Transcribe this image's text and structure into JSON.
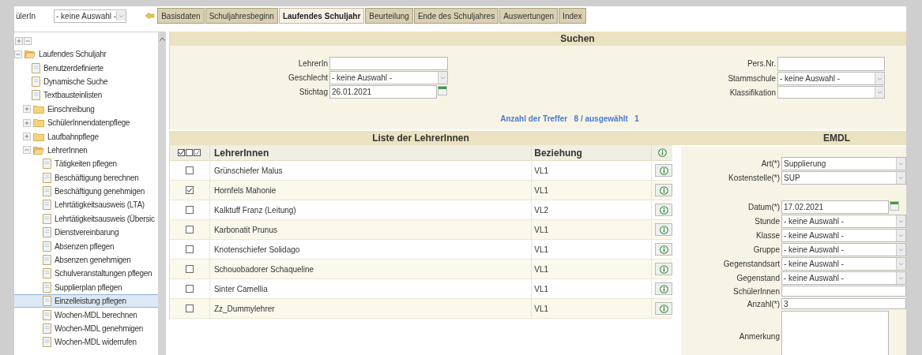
{
  "top_bar": {
    "label": "ülerIn",
    "select_value": "- keine Auswahl -"
  },
  "tabs": [
    {
      "label": "Basisdaten",
      "selected": false
    },
    {
      "label": "Schuljahresbeginn",
      "selected": false
    },
    {
      "label": "Laufendes Schuljahr",
      "selected": true
    },
    {
      "label": "Beurteilung",
      "selected": false
    },
    {
      "label": "Ende des Schuljahres",
      "selected": false
    },
    {
      "label": "Auswertungen",
      "selected": false
    },
    {
      "label": "Index",
      "selected": false
    }
  ],
  "sidebar": {
    "tree": [
      {
        "label": "Laufendes Schuljahr",
        "kind": "folder",
        "expanded": true,
        "selected": false,
        "children": [
          {
            "label": "Benutzerdefinierte",
            "kind": "page",
            "selected": false
          },
          {
            "label": "Dynamische Suche",
            "kind": "page",
            "selected": false
          },
          {
            "label": "Textbausteinlisten",
            "kind": "page",
            "selected": false
          },
          {
            "label": "Einschreibung",
            "kind": "folder",
            "expanded": false,
            "selected": false
          },
          {
            "label": "SchülerInnendatenpflege",
            "kind": "folder",
            "expanded": false,
            "selected": false
          },
          {
            "label": "Laufbahnpflege",
            "kind": "folder",
            "expanded": false,
            "selected": false
          },
          {
            "label": "LehrerInnen",
            "kind": "folder",
            "expanded": true,
            "selected": false,
            "children": [
              {
                "label": "Tätigkeiten pflegen",
                "kind": "page",
                "selected": false
              },
              {
                "label": "Beschäftigung berechnen",
                "kind": "page",
                "selected": false
              },
              {
                "label": "Beschäftigung genehmigen",
                "kind": "page",
                "selected": false
              },
              {
                "label": "Lehrtätigkeitsausweis (LTA)",
                "kind": "page",
                "selected": false
              },
              {
                "label": "Lehrtätigkeitsausweis (Übersic",
                "kind": "page",
                "selected": false
              },
              {
                "label": "Dienstvereinbarung",
                "kind": "page",
                "selected": false
              },
              {
                "label": "Absenzen pflegen",
                "kind": "page",
                "selected": false
              },
              {
                "label": "Absenzen genehmigen",
                "kind": "page",
                "selected": false
              },
              {
                "label": "Schulveranstaltungen pflegen",
                "kind": "page",
                "selected": false
              },
              {
                "label": "Supplierplan pflegen",
                "kind": "page",
                "selected": false
              },
              {
                "label": "Einzelleistung pflegen",
                "kind": "page",
                "selected": true
              },
              {
                "label": "Wochen-MDL berechnen",
                "kind": "page",
                "selected": false
              },
              {
                "label": "Wochen-MDL genehmigen",
                "kind": "page",
                "selected": false
              },
              {
                "label": "Wochen-MDL widerrufen",
                "kind": "page",
                "selected": false
              }
            ]
          }
        ]
      }
    ]
  },
  "search": {
    "title": "Suchen",
    "left_fields": [
      {
        "label": "LehrerIn",
        "kind": "text"
      },
      {
        "label": "Geschlecht",
        "kind": "select",
        "value": "- keine Auswahl -"
      },
      {
        "label": "Stichtag",
        "kind": "date",
        "value": "26.01.2021"
      }
    ],
    "right_fields": [
      {
        "label": "Pers.Nr.",
        "kind": "text"
      },
      {
        "label": "Stammschule",
        "kind": "select",
        "value": "- keine Auswahl -"
      },
      {
        "label": "Klassifikation",
        "kind": "select"
      }
    ],
    "result_count": "Anzahl der Treffer   8 / ausgewählt   1"
  },
  "teacher_list": {
    "title": "Liste der LehrerInnen",
    "columns": [
      "LehrerInnen",
      "Beziehung"
    ],
    "rows": [
      {
        "name": "Grünschiefer Malus",
        "relation": "VL1",
        "checked": false
      },
      {
        "name": "Hornfels Mahonie",
        "relation": "VL1",
        "checked": true
      },
      {
        "name": "Kalktuff Franz (Leitung)",
        "relation": "VL2",
        "checked": false
      },
      {
        "name": "Karbonatit Prunus",
        "relation": "VL1",
        "checked": false
      },
      {
        "name": "Knotenschiefer Solidago",
        "relation": "VL1",
        "checked": false
      },
      {
        "name": "Schouobadorer Schaqueline",
        "relation": "VL1",
        "checked": false
      },
      {
        "name": "Sinter Camellia",
        "relation": "VL1",
        "checked": false
      },
      {
        "name": "Zz_Dummylehrer",
        "relation": "VL1",
        "checked": false
      }
    ]
  },
  "emdl": {
    "title": "EMDL",
    "field_groups": [
      [
        {
          "label": "Art(*)",
          "kind": "select",
          "value": "Supplierung"
        },
        {
          "label": "Kostenstelle(*)",
          "kind": "select",
          "value": "SUP"
        }
      ],
      [
        {
          "label": "Datum(*)",
          "kind": "date",
          "value": "17.02.2021"
        },
        {
          "label": "Stunde",
          "kind": "select",
          "value": "- keine Auswahl -"
        },
        {
          "label": "Klasse",
          "kind": "select",
          "value": "- keine Auswahl -"
        },
        {
          "label": "Gruppe",
          "kind": "select",
          "value": "- keine Auswahl -"
        },
        {
          "label": "Gegenstandsart",
          "kind": "select",
          "value": "- keine Auswahl -"
        },
        {
          "label": "Gegenstand",
          "kind": "select",
          "value": "- keine Auswahl -"
        },
        {
          "label": "SchülerInnen",
          "kind": "text"
        },
        {
          "label": "Anzahl(*)",
          "kind": "text",
          "value": "3"
        },
        {
          "label": "Anmerkung",
          "kind": "textarea"
        }
      ]
    ]
  }
}
